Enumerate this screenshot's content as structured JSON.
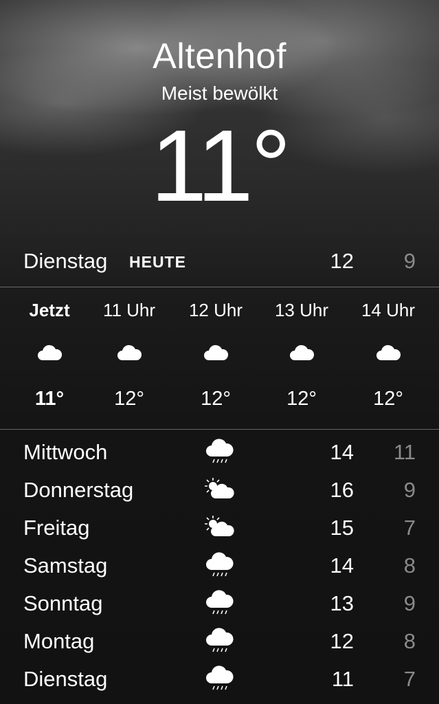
{
  "location": {
    "city": "Altenhof",
    "condition": "Meist bewölkt",
    "current_temp": "11°"
  },
  "today": {
    "day": "Dienstag",
    "tag": "HEUTE",
    "high": "12",
    "low": "9"
  },
  "hourly": [
    {
      "time": "Jetzt",
      "icon": "cloud-icon",
      "temp": "11°"
    },
    {
      "time": "11 Uhr",
      "icon": "cloud-icon",
      "temp": "12°"
    },
    {
      "time": "12 Uhr",
      "icon": "cloud-icon",
      "temp": "12°"
    },
    {
      "time": "13 Uhr",
      "icon": "cloud-icon",
      "temp": "12°"
    },
    {
      "time": "14 Uhr",
      "icon": "cloud-icon",
      "temp": "12°"
    }
  ],
  "daily": [
    {
      "day": "Mittwoch",
      "icon": "cloud-drizzle-icon",
      "high": "14",
      "low": "11"
    },
    {
      "day": "Donnerstag",
      "icon": "partly-sunny-icon",
      "high": "16",
      "low": "9"
    },
    {
      "day": "Freitag",
      "icon": "partly-sunny-icon",
      "high": "15",
      "low": "7"
    },
    {
      "day": "Samstag",
      "icon": "cloud-drizzle-icon",
      "high": "14",
      "low": "8"
    },
    {
      "day": "Sonntag",
      "icon": "cloud-drizzle-icon",
      "high": "13",
      "low": "9"
    },
    {
      "day": "Montag",
      "icon": "cloud-drizzle-icon",
      "high": "12",
      "low": "8"
    },
    {
      "day": "Dienstag",
      "icon": "cloud-drizzle-icon",
      "high": "11",
      "low": "7"
    }
  ],
  "colors": {
    "text": "#ffffff",
    "low_temp": "#8a8a8a"
  }
}
